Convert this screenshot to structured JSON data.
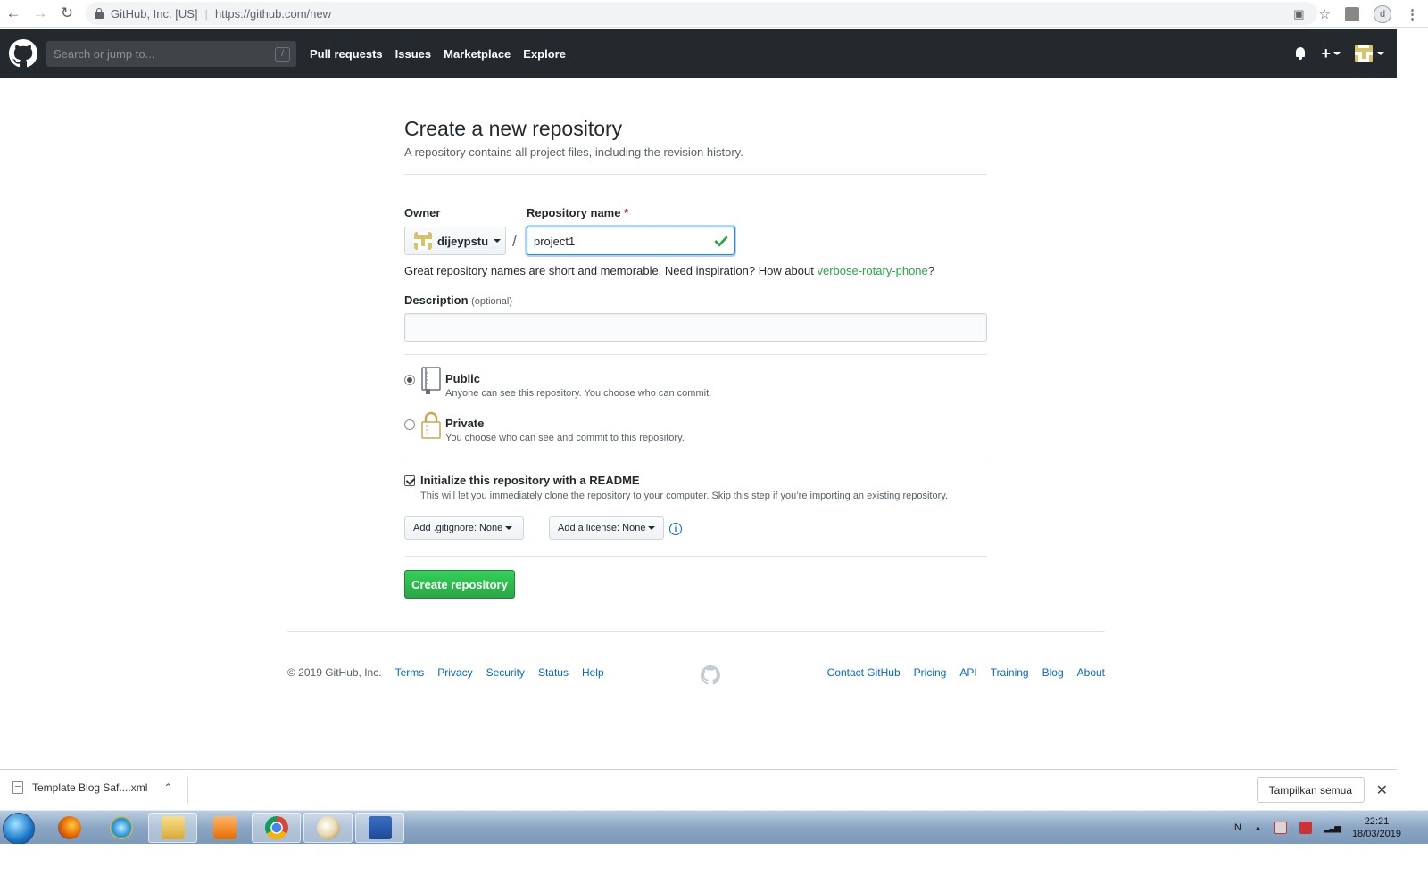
{
  "browser": {
    "site_identity": "GitHub, Inc. [US]",
    "url": "https://github.com/new",
    "profile_initial": "d"
  },
  "header": {
    "search_placeholder": "Search or jump to...",
    "search_shortcut": "/",
    "nav": [
      "Pull requests",
      "Issues",
      "Marketplace",
      "Explore"
    ]
  },
  "main": {
    "title": "Create a new repository",
    "subtitle": "A repository contains all project files, including the revision history.",
    "owner_label": "Owner",
    "repo_name_label": "Repository name",
    "required_mark": "*",
    "owner_value": "dijeypstu",
    "slash": "/",
    "repo_name_value": "project1",
    "hint_prefix": "Great repository names are short and memorable. Need inspiration? How about ",
    "hint_suggestion": "verbose-rotary-phone",
    "hint_suffix": "?",
    "description_label": "Description",
    "description_optional": "(optional)",
    "description_value": "",
    "visibility": {
      "public_title": "Public",
      "public_desc": "Anyone can see this repository. You choose who can commit.",
      "private_title": "Private",
      "private_desc": "You choose who can see and commit to this repository.",
      "selected": "public"
    },
    "init_readme_title": "Initialize this repository with a README",
    "init_readme_desc": "This will let you immediately clone the repository to your computer. Skip this step if you’re importing an existing repository.",
    "init_readme_checked": true,
    "gitignore_label": "Add .gitignore: None",
    "license_label": "Add a license: None",
    "info_glyph": "i",
    "create_button": "Create repository"
  },
  "footer": {
    "copyright": "© 2019 GitHub, Inc.",
    "left_links": [
      "Terms",
      "Privacy",
      "Security",
      "Status",
      "Help"
    ],
    "right_links": [
      "Contact GitHub",
      "Pricing",
      "API",
      "Training",
      "Blog",
      "About"
    ]
  },
  "download_shelf": {
    "file_name": "Template Blog Saf....xml",
    "show_all": "Tampilkan semua"
  },
  "taskbar": {
    "language": "IN",
    "time": "22:21",
    "date": "18/03/2019"
  },
  "colors": {
    "header_bg": "#24292e",
    "accent_green": "#28a745",
    "link_blue": "#0366d6"
  }
}
